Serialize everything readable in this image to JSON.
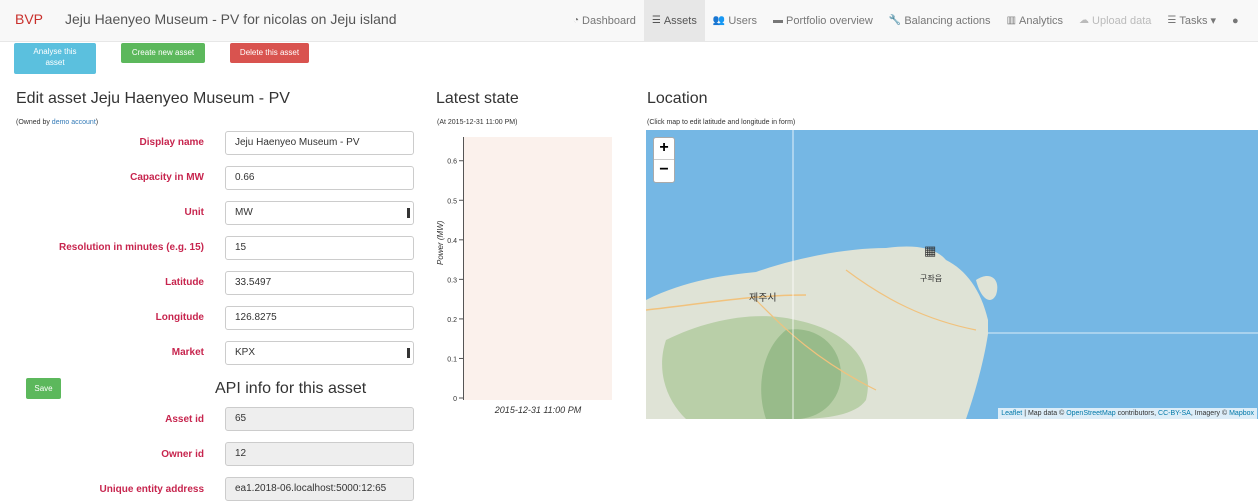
{
  "navbar": {
    "brand": "BVP",
    "title": "Jeju Haenyeo Museum - PV for nicolas on Jeju island",
    "items": [
      {
        "label": "Dashboard",
        "icon": "dashboard-icon"
      },
      {
        "label": "Assets",
        "icon": "list-icon"
      },
      {
        "label": "Users",
        "icon": "users-icon"
      },
      {
        "label": "Portfolio overview",
        "icon": "briefcase-icon"
      },
      {
        "label": "Balancing actions",
        "icon": "wrench-icon"
      },
      {
        "label": "Analytics",
        "icon": "bar-chart-icon"
      },
      {
        "label": "Upload data",
        "icon": "cloud-upload-icon"
      },
      {
        "label": "Tasks ▾",
        "icon": "tasks-icon"
      }
    ]
  },
  "actions": {
    "analyse_line1": "Analyse this",
    "analyse_line2": "asset",
    "create": "Create new asset",
    "delete": "Delete this asset",
    "save": "Save"
  },
  "form": {
    "heading": "Edit asset Jeju Haenyeo Museum - PV",
    "owned_prefix": "(Owned by ",
    "owner_link": "demo account",
    "owned_suffix": ")",
    "fields": [
      {
        "label": "Display name",
        "value": "Jeju Haenyeo Museum - PV"
      },
      {
        "label": "Capacity in MW",
        "value": "0.66"
      },
      {
        "label": "Unit",
        "value": "MW"
      },
      {
        "label": "Resolution in minutes (e.g. 15)",
        "value": "15"
      },
      {
        "label": "Latitude",
        "value": "33.5497"
      },
      {
        "label": "Longitude",
        "value": "126.8275"
      },
      {
        "label": "Market",
        "value": "KPX"
      }
    ]
  },
  "api": {
    "heading": "API info for this asset",
    "fields": [
      {
        "label": "Asset id",
        "value": "65"
      },
      {
        "label": "Owner id",
        "value": "12"
      },
      {
        "label": "Unique entity address",
        "value": "ea1.2018-06.localhost:5000:12:65"
      }
    ]
  },
  "latest": {
    "heading": "Latest state",
    "timestamp": "(At 2015-12-31 11:00 PM)"
  },
  "chart_data": {
    "type": "bar",
    "categories": [
      "2015-12-31 11:00 PM"
    ],
    "values": [
      0
    ],
    "xlabel": "",
    "ylabel": "Power (MW)",
    "ylim": [
      0,
      0.66
    ],
    "yticks": [
      "0",
      "0.1",
      "0.2",
      "0.3",
      "0.4",
      "0.5",
      "0.6"
    ]
  },
  "location": {
    "heading": "Location",
    "hint": "(Click map to edit latitude and longitude in form)",
    "zoom_in": "+",
    "zoom_out": "−",
    "city_label": "제주시",
    "town_label": "구좌읍",
    "attribution": {
      "leaflet": "Leaflet",
      "mid1": " | Map data © ",
      "osm": "OpenStreetMap",
      "mid2": " contributors, ",
      "cc": "CC-BY-SA",
      "mid3": ", Imagery © ",
      "mapbox": "Mapbox"
    }
  }
}
